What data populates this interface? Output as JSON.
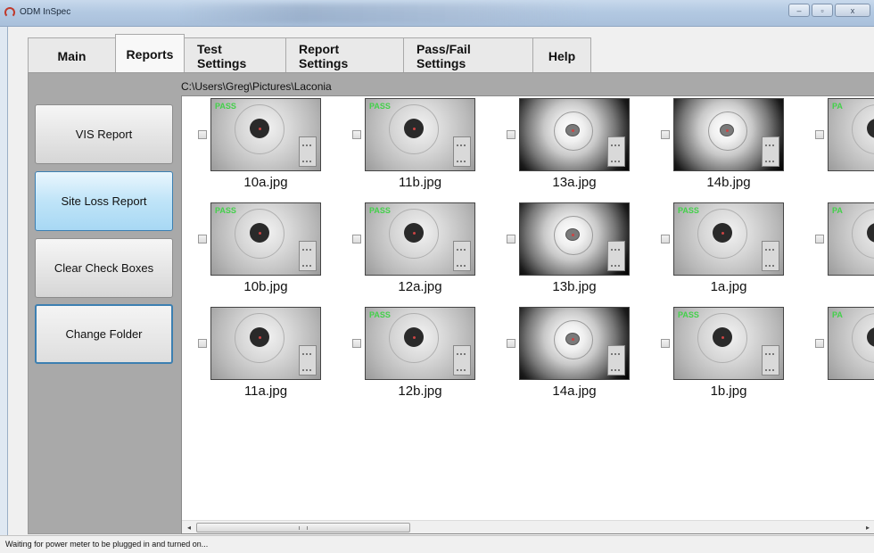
{
  "window": {
    "title": "ODM InSpec",
    "controls": {
      "minimize": "–",
      "maximize": "▫",
      "close": "x"
    }
  },
  "tabs": [
    {
      "label": "Main",
      "selected": false
    },
    {
      "label": "Reports",
      "selected": true
    },
    {
      "label": "Test Settings",
      "selected": false
    },
    {
      "label": "Report Settings",
      "selected": false
    },
    {
      "label": "Pass/Fail Settings",
      "selected": false
    },
    {
      "label": "Help",
      "selected": false
    }
  ],
  "sidebar": {
    "buttons": [
      {
        "label": "VIS Report"
      },
      {
        "label": "Site Loss Report"
      },
      {
        "label": "Clear Check Boxes"
      },
      {
        "label": "Change Folder"
      }
    ]
  },
  "folder_path": "C:\\Users\\Greg\\Pictures\\Laconia",
  "thumbnails": [
    {
      "name": "10a.jpg",
      "style": "light",
      "badge": "PASS",
      "checked": false
    },
    {
      "name": "11b.jpg",
      "style": "light",
      "badge": "PASS",
      "checked": false
    },
    {
      "name": "13a.jpg",
      "style": "dark",
      "badge": "",
      "checked": false
    },
    {
      "name": "14b.jpg",
      "style": "dark",
      "badge": "",
      "checked": false
    },
    {
      "name": "",
      "style": "light",
      "badge": "PA",
      "checked": false
    },
    {
      "name": "10b.jpg",
      "style": "light",
      "badge": "PASS",
      "checked": false
    },
    {
      "name": "12a.jpg",
      "style": "light",
      "badge": "PASS",
      "checked": false
    },
    {
      "name": "13b.jpg",
      "style": "dark",
      "badge": "",
      "checked": false
    },
    {
      "name": "1a.jpg",
      "style": "light",
      "badge": "PASS",
      "checked": false
    },
    {
      "name": "",
      "style": "light",
      "badge": "PA",
      "checked": false
    },
    {
      "name": "11a.jpg",
      "style": "light",
      "badge": "",
      "checked": false
    },
    {
      "name": "12b.jpg",
      "style": "light",
      "badge": "PASS",
      "checked": false
    },
    {
      "name": "14a.jpg",
      "style": "dark",
      "badge": "",
      "checked": false
    },
    {
      "name": "1b.jpg",
      "style": "light",
      "badge": "PASS",
      "checked": false
    },
    {
      "name": "",
      "style": "light",
      "badge": "PA",
      "checked": false
    }
  ],
  "status_text": "Waiting for power meter to be plugged in and turned on...",
  "colors": {
    "pass_badge": "#43d14a",
    "active_button": "#bfe4f8",
    "focus_border": "#3c7fb1"
  },
  "icons": {
    "app": "odm-inspec-logo-icon",
    "scroll_left": "arrow-left-icon",
    "scroll_right": "arrow-right-icon"
  }
}
